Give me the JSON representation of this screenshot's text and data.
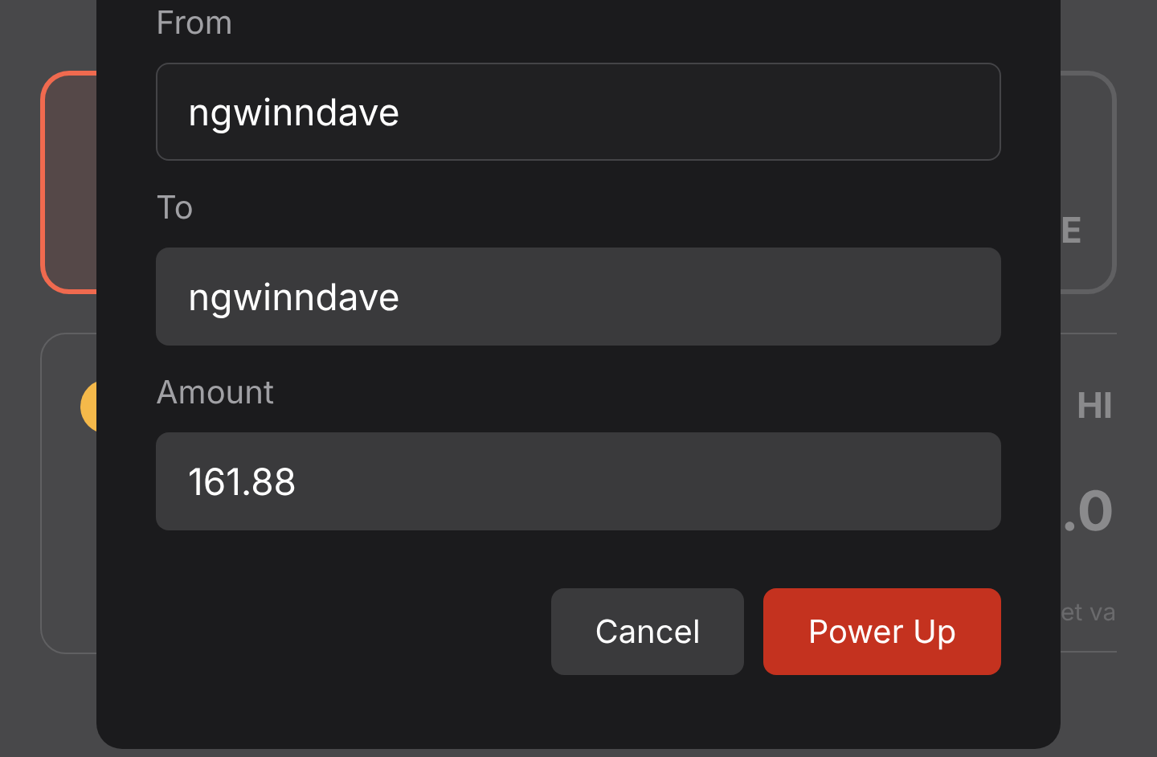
{
  "background": {
    "cards": [
      {
        "selected": true
      },
      {
        "selected": false,
        "text": "E"
      }
    ],
    "stats": [
      {
        "heading": "HI",
        "value": ".0",
        "caption": "et va"
      }
    ]
  },
  "dialog": {
    "fields": [
      {
        "label": "From",
        "value": "ngwinndave",
        "disabled": true
      },
      {
        "label": "To",
        "value": "ngwinndave",
        "disabled": false
      },
      {
        "label": "Amount",
        "value": "161.88",
        "disabled": false
      }
    ],
    "buttons": [
      {
        "label": "Cancel",
        "kind": "secondary"
      },
      {
        "label": "Power Up",
        "kind": "primary"
      }
    ]
  }
}
